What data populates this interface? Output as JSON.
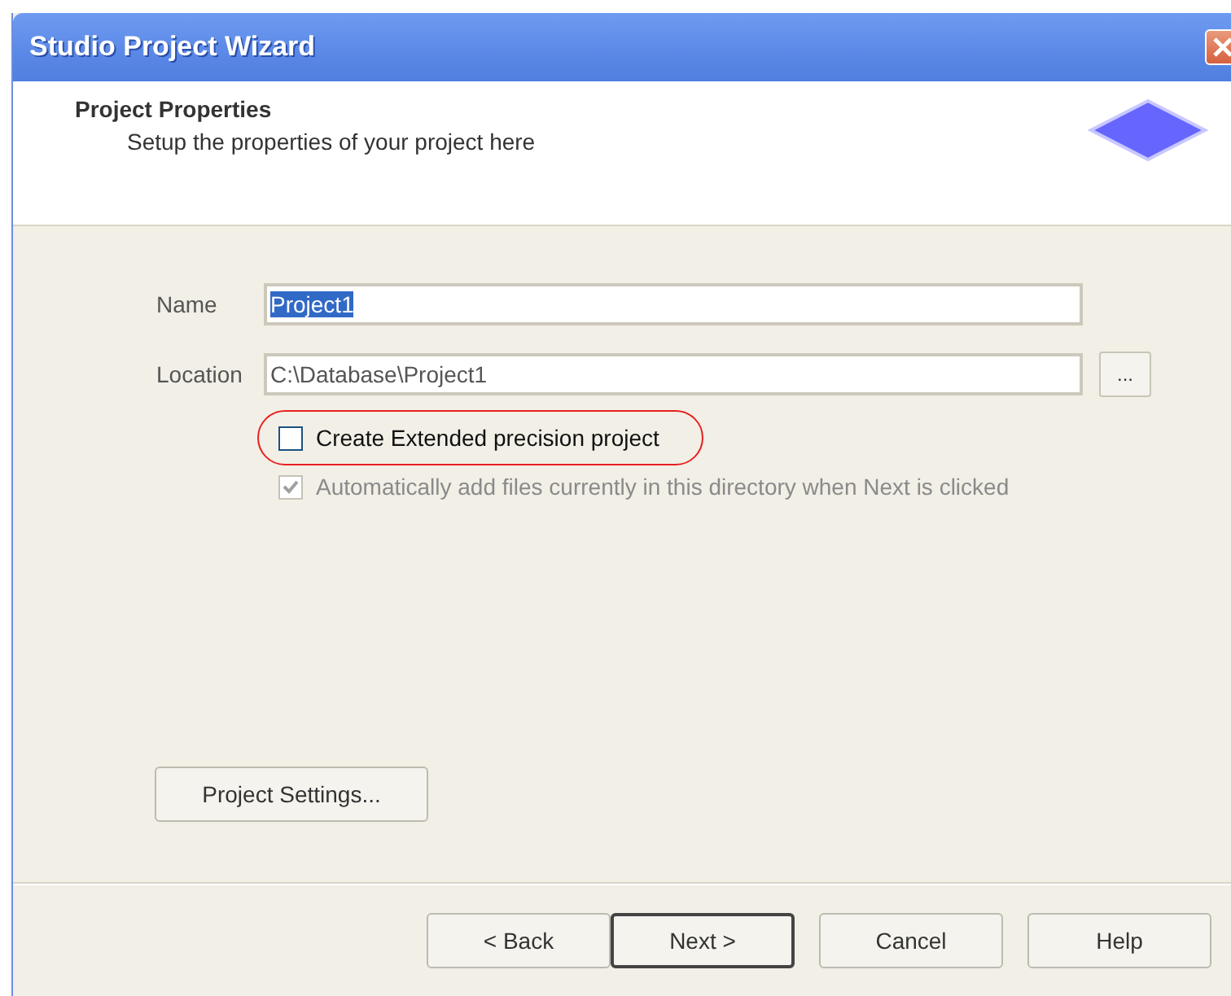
{
  "window": {
    "title": "Studio Project Wizard"
  },
  "header": {
    "title": "Project Properties",
    "subtitle": "Setup the properties of your project here"
  },
  "fields": [
    {
      "label": "Name",
      "value": "Project1",
      "text_selected": true,
      "browse": false
    },
    {
      "label": "Location",
      "value": "C:\\Database\\Project1",
      "text_selected": false,
      "browse": true,
      "browse_label": "..."
    }
  ],
  "checkboxes": [
    {
      "label": "Create Extended precision project",
      "checked": false,
      "disabled": false,
      "circled": true
    },
    {
      "label": "Automatically add files currently in this directory when Next is clicked",
      "checked": true,
      "disabled": true,
      "circled": false
    }
  ],
  "settings_button": "Project Settings...",
  "buttons": [
    {
      "label": "< Back",
      "default": false
    },
    {
      "label": "Next >",
      "default": true
    },
    {
      "label": "Cancel",
      "default": false
    },
    {
      "label": "Help",
      "default": false
    }
  ]
}
